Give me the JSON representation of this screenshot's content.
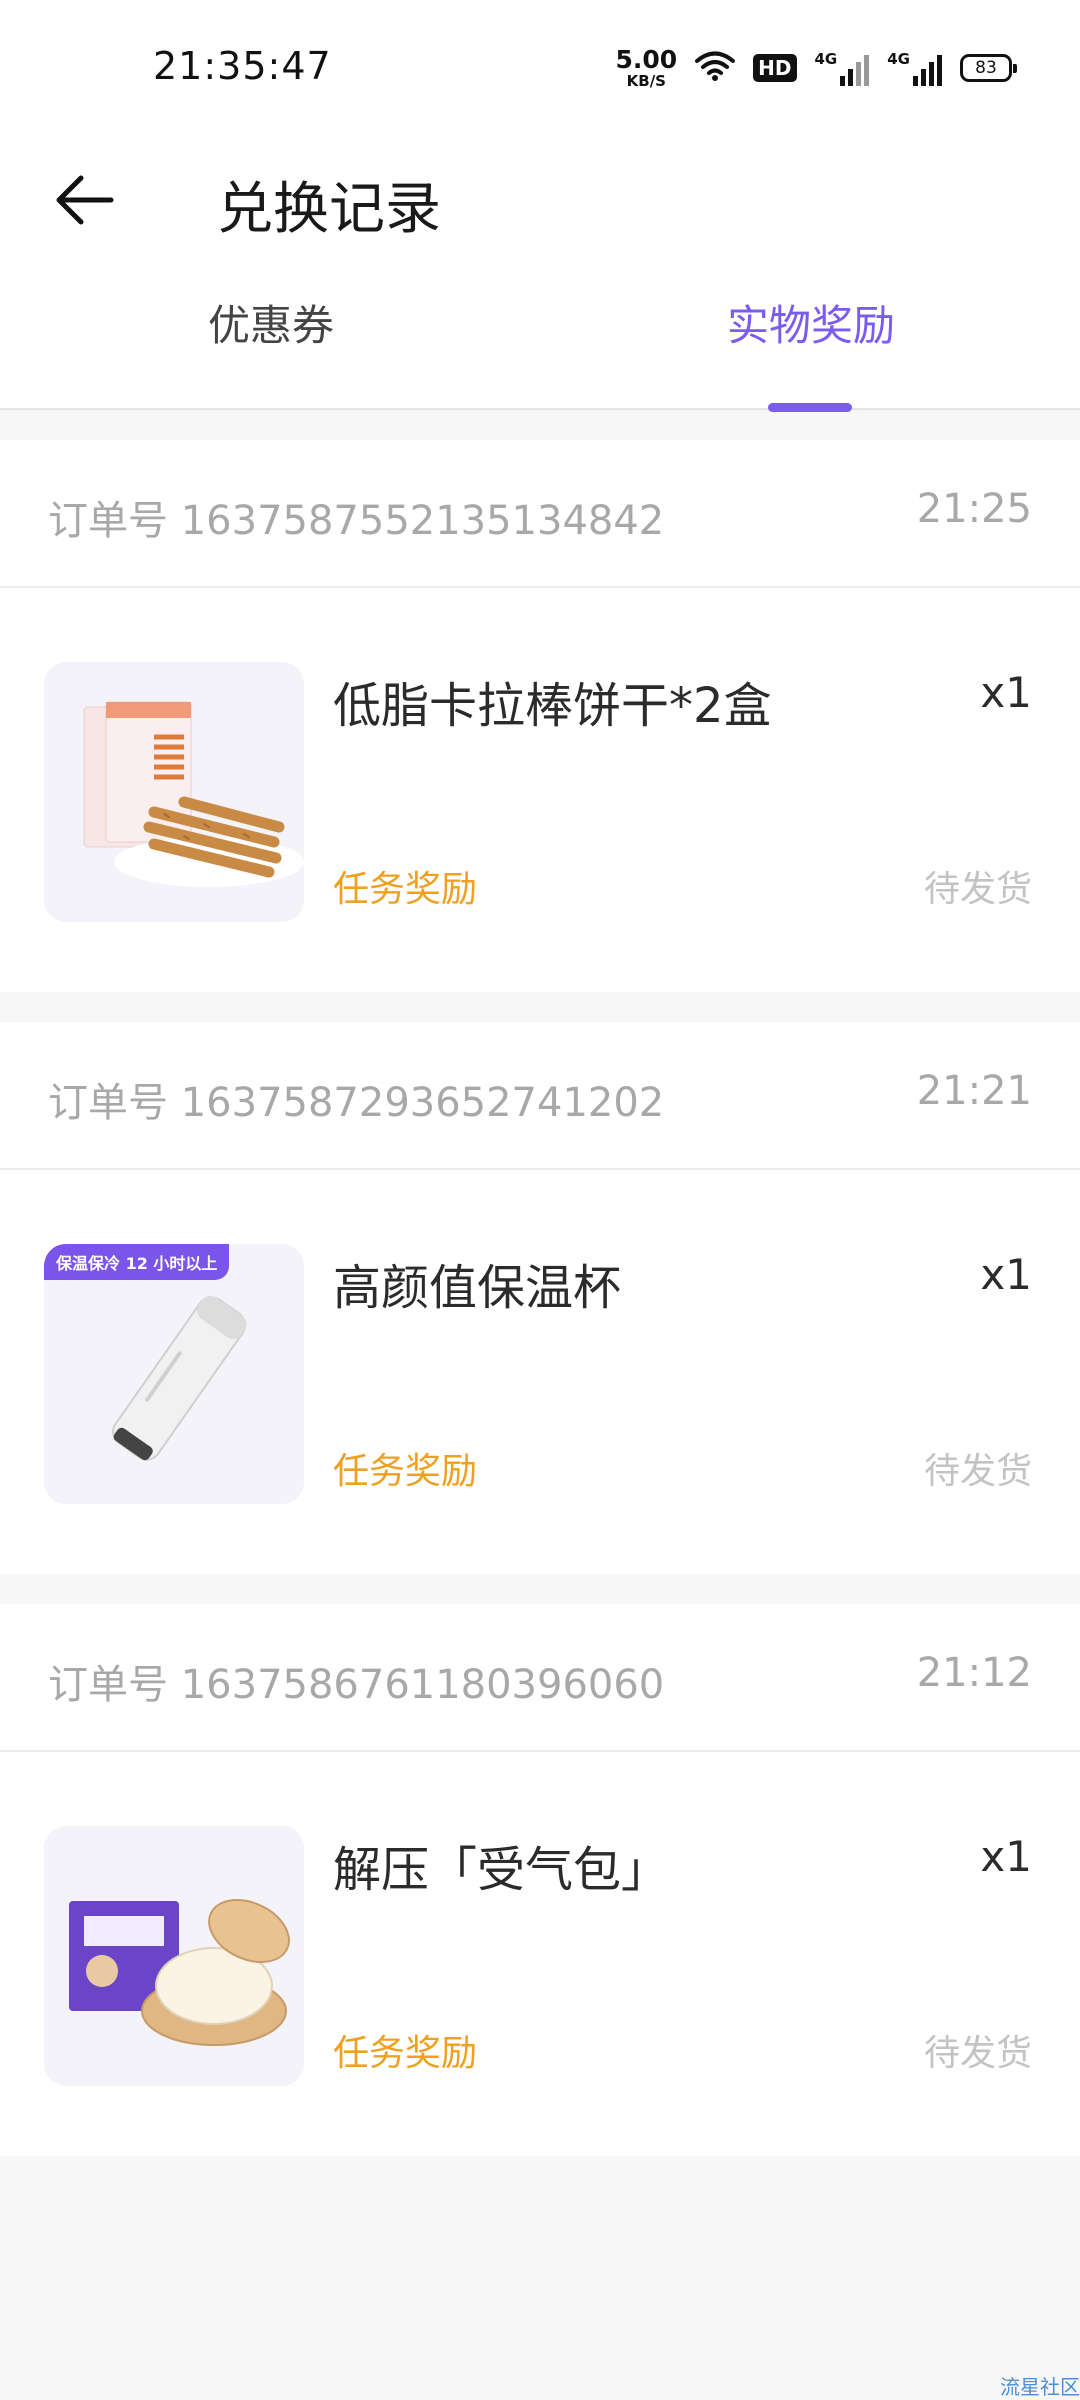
{
  "status_bar": {
    "time": "21:35:47",
    "net_speed": "5.00",
    "net_speed_unit": "KB/S",
    "hd_label": "HD",
    "sim1_label": "4G",
    "sim2_label": "4G",
    "battery": "83"
  },
  "header": {
    "title": "兑换记录",
    "back_icon": "arrow-left-icon"
  },
  "tabs": [
    {
      "label": "优惠券",
      "active": false
    },
    {
      "label": "实物奖励",
      "active": true
    }
  ],
  "colors": {
    "accent": "#7a5cf0",
    "reward_orange": "#f0a020",
    "muted_text": "#a8a8a8"
  },
  "orders": [
    {
      "order_label": "订单号",
      "order_no": "1637587552135134842",
      "time": "21:25",
      "item_name": "低脂卡拉棒饼干*2盒",
      "qty": "x1",
      "source": "任务奖励",
      "status": "待发货"
    },
    {
      "order_label": "订单号",
      "order_no": "1637587293652741202",
      "time": "21:21",
      "item_name": "高颜值保温杯",
      "qty": "x1",
      "source": "任务奖励",
      "status": "待发货",
      "badge": "保温保冷 12 小时以上"
    },
    {
      "order_label": "订单号",
      "order_no": "1637586761180396060",
      "time": "21:12",
      "item_name": "解压「受气包」",
      "qty": "x1",
      "source": "任务奖励",
      "status": "待发货"
    }
  ],
  "watermark": "流星社区"
}
